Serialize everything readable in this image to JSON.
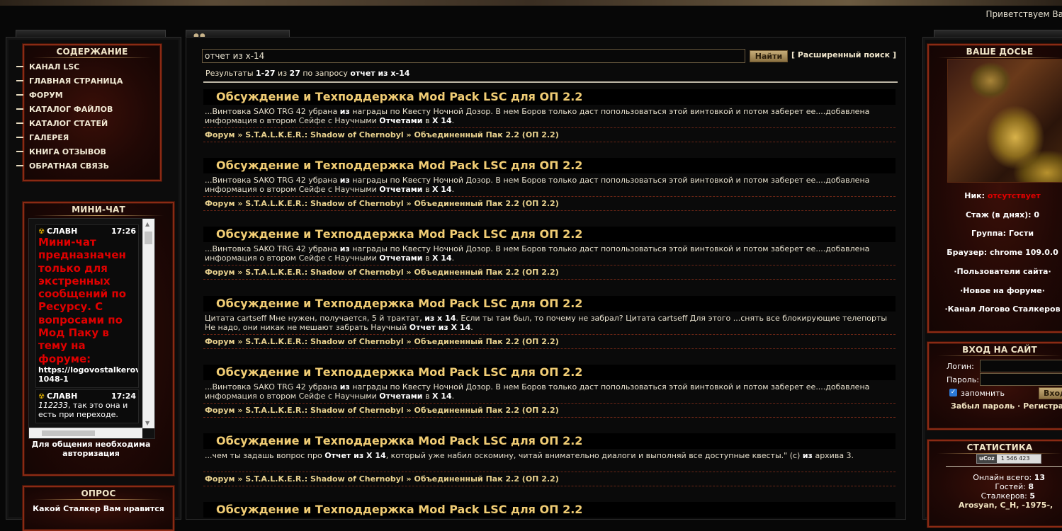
{
  "header": {
    "greeting": "Приветствуем Ва"
  },
  "left": {
    "menu_title": "СОДЕРЖАНИЕ",
    "menu": [
      "КАНАЛ LSC",
      "ГЛАВНАЯ СТРАНИЦА",
      "ФОРУМ",
      "КАТАЛОГ ФАЙЛОВ",
      "КАТАЛОГ СТАТЕЙ",
      "ГАЛЕРЕЯ",
      "КНИГА ОТЗЫВОВ",
      "ОБРАТНАЯ СВЯЗЬ"
    ],
    "chat_title": "МИНИ-ЧАТ",
    "chat": [
      {
        "author": "СЛАВН",
        "time": "17:26",
        "text": "Мини-чат предназначен только для экстренных сообщений по Ресурсу. С вопросами по Мод Паку в тему на форуме:",
        "link": "https://logovostalkerov",
        "link2": "1048-1"
      },
      {
        "author": "СЛАВН",
        "time": "17:24",
        "quote": "112233",
        "text": ", так это она и есть при переходе."
      }
    ],
    "chat_note": "Для общения необходима авторизация",
    "poll_title": "ОПРОС",
    "poll_question": "Какой Сталкер Вам нравится"
  },
  "search": {
    "query": "отчет из х-14",
    "button": "Найти",
    "advanced": "[ Расширенный поиск ]",
    "summary_prefix": "Результаты ",
    "summary_range": "1-27",
    "summary_of": " из ",
    "summary_total": "27",
    "summary_by": " по запросу ",
    "summary_query": "отчет из х-14"
  },
  "results": [
    {
      "title": "Обсуждение и Техподдержка Mod Pack LSC для ОП 2.2",
      "snippet": [
        [
          "...Винтовка SAKO TRG 42 убрана ",
          false
        ],
        [
          "из",
          true
        ],
        [
          " награды по Квесту Ночной Дозор. В нем Боров только даст попользоваться этой винтовкой и потом заберет ее....добавлена информация о втором Сейфе с Научными ",
          false
        ],
        [
          "Отчетами",
          true
        ],
        [
          " в ",
          false
        ],
        [
          "Х 14",
          true
        ],
        [
          ".",
          false
        ]
      ],
      "path": "Форум » S.T.A.L.K.E.R.: Shadow of Chernobyl » Объединенный Пак 2.2 (ОП 2.2)"
    },
    {
      "title": "Обсуждение и Техподдержка Mod Pack LSC для ОП 2.2",
      "snippet": [
        [
          "...Винтовка SAKO TRG 42 убрана ",
          false
        ],
        [
          "из",
          true
        ],
        [
          " награды по Квесту Ночной Дозор. В нем Боров только даст попользоваться этой винтовкой и потом заберет ее....добавлена информация о втором Сейфе с Научными ",
          false
        ],
        [
          "Отчетами",
          true
        ],
        [
          " в ",
          false
        ],
        [
          "Х 14",
          true
        ],
        [
          ".",
          false
        ]
      ],
      "path": "Форум » S.T.A.L.K.E.R.: Shadow of Chernobyl » Объединенный Пак 2.2 (ОП 2.2)"
    },
    {
      "title": "Обсуждение и Техподдержка Mod Pack LSC для ОП 2.2",
      "snippet": [
        [
          "...Винтовка SAKO TRG 42 убрана ",
          false
        ],
        [
          "из",
          true
        ],
        [
          " награды по Квесту Ночной Дозор. В нем Боров только даст попользоваться этой винтовкой и потом заберет ее....добавлена информация о втором Сейфе с Научными ",
          false
        ],
        [
          "Отчетами",
          true
        ],
        [
          " в ",
          false
        ],
        [
          "Х 14",
          true
        ],
        [
          ".",
          false
        ]
      ],
      "path": "Форум » S.T.A.L.K.E.R.: Shadow of Chernobyl » Объединенный Пак 2.2 (ОП 2.2)"
    },
    {
      "title": "Обсуждение и Техподдержка Mod Pack LSC для ОП 2.2",
      "snippet": [
        [
          "Цитата cartseff Мне нужен, получается, 5 й трактат, ",
          false
        ],
        [
          "из х 14",
          true
        ],
        [
          ". Если ты там был, то почему не забрал? Цитата cartseff Для этого ...снять все блокирующие телепорты Не надо, они никак не мешают забрать Научный ",
          false
        ],
        [
          "Отчет из Х 14",
          true
        ],
        [
          ".",
          false
        ]
      ],
      "path": "Форум » S.T.A.L.K.E.R.: Shadow of Chernobyl » Объединенный Пак 2.2 (ОП 2.2)"
    },
    {
      "title": "Обсуждение и Техподдержка Mod Pack LSC для ОП 2.2",
      "snippet": [
        [
          "...Винтовка SAKO TRG 42 убрана ",
          false
        ],
        [
          "из",
          true
        ],
        [
          " награды по Квесту Ночной Дозор. В нем Боров только даст попользоваться этой винтовкой и потом заберет ее....добавлена информация о втором Сейфе с Научными ",
          false
        ],
        [
          "Отчетами",
          true
        ],
        [
          " в ",
          false
        ],
        [
          "Х 14",
          true
        ],
        [
          ".",
          false
        ]
      ],
      "path": "Форум » S.T.A.L.K.E.R.: Shadow of Chernobyl » Объединенный Пак 2.2 (ОП 2.2)"
    },
    {
      "title": "Обсуждение и Техподдержка Mod Pack LSC для ОП 2.2",
      "snippet": [
        [
          "...чем ты задашь вопрос про ",
          false
        ],
        [
          "Отчет из Х 14",
          true
        ],
        [
          ", который уже набил оскомину, читай внимательно диалоги и выполняй все доступные квесты.\" (с) ",
          false
        ],
        [
          "из",
          true
        ],
        [
          " архива 3.",
          false
        ]
      ],
      "path": "Форум » S.T.A.L.K.E.R.: Shadow of Chernobyl » Объединенный Пак 2.2 (ОП 2.2)"
    },
    {
      "title": "Обсуждение и Техподдержка Mod Pack LSC для ОП 2.2",
      "snippet": [],
      "path": ""
    }
  ],
  "right": {
    "dossier_title": "ВАШЕ ДОСЬЕ",
    "nick_label": "Ник: ",
    "nick_value": "отсутствует",
    "stazh": "Стаж (в днях): 0",
    "group": "Группа: Гости",
    "browser": "Браузер: chrome 109.0.0",
    "link_users": "·Пользователи сайта·",
    "link_new": "·Новое на форуме·",
    "link_channel": "·Канал Логово Сталкеров",
    "login_title": "ВХОД НА САЙТ",
    "login_label": "Логин:",
    "password_label": "Пароль:",
    "remember": "запомнить",
    "login_button": "Вход",
    "forgot": "Забыл пароль",
    "register": "Регистрация",
    "login_links_sep": " · ",
    "stats_title": "СТАТИСТИКА",
    "counter_brand": "uCoz",
    "counter_value": "1 546 423",
    "online_label": "Онлайн всего: ",
    "online_value": "13",
    "guests_label": "Гостей: ",
    "guests_value": "8",
    "stalkers_label": "Сталкеров: ",
    "stalkers_value": "5",
    "users_list": "Arosyan, C_H, -1975-,"
  },
  "colors": {
    "accent_red": "#e00000",
    "title_gold": "#f0cc74",
    "path_gold": "#e9d28f",
    "border_red": "#8a2a14"
  }
}
